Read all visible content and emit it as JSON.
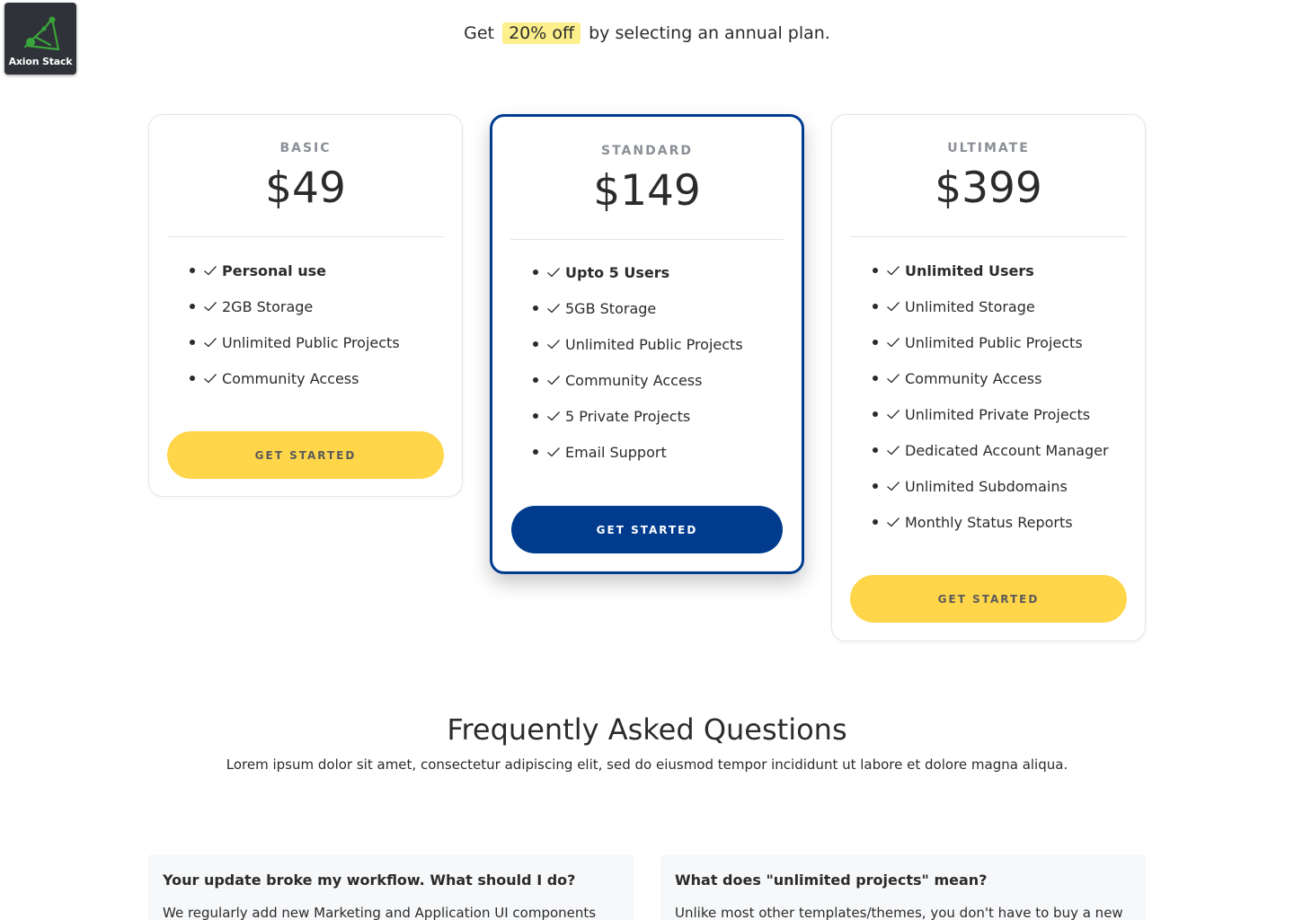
{
  "logo": {
    "text": "Axion Stack",
    "icon": "axion-stack-logo-icon"
  },
  "promo": {
    "prefix": "Get",
    "highlight": "20% off",
    "suffix": "by selecting an annual plan."
  },
  "plans": [
    {
      "tier": "BASIC",
      "price": "$49",
      "features": [
        "Personal use",
        "2GB Storage",
        "Unlimited Public Projects",
        "Community Access"
      ],
      "button": "GET STARTED"
    },
    {
      "tier": "STANDARD",
      "price": "$149",
      "features": [
        "Upto 5 Users",
        "5GB Storage",
        "Unlimited Public Projects",
        "Community Access",
        "5 Private Projects",
        "Email Support"
      ],
      "button": "GET STARTED"
    },
    {
      "tier": "ULTIMATE",
      "price": "$399",
      "features": [
        "Unlimited Users",
        "Unlimited Storage",
        "Unlimited Public Projects",
        "Community Access",
        "Unlimited Private Projects",
        "Dedicated Account Manager",
        "Unlimited Subdomains",
        "Monthly Status Reports"
      ],
      "button": "GET STARTED"
    }
  ],
  "faq": {
    "title": "Frequently Asked Questions",
    "subtitle": "Lorem ipsum dolor sit amet, consectetur adipiscing elit, sed do eiusmod tempor incididunt ut labore et dolore magna aliqua.",
    "items": [
      {
        "question": "Your update broke my workflow. What should I do?",
        "answer": "We regularly add new Marketing and Application UI components"
      },
      {
        "question": "What does \"unlimited projects\" mean?",
        "answer": "Unlike most other templates/themes, you don't have to buy a new"
      }
    ]
  },
  "colors": {
    "accent": "#003b8e",
    "button_yellow": "#ffd54a",
    "highlight": "#fdf08c"
  }
}
